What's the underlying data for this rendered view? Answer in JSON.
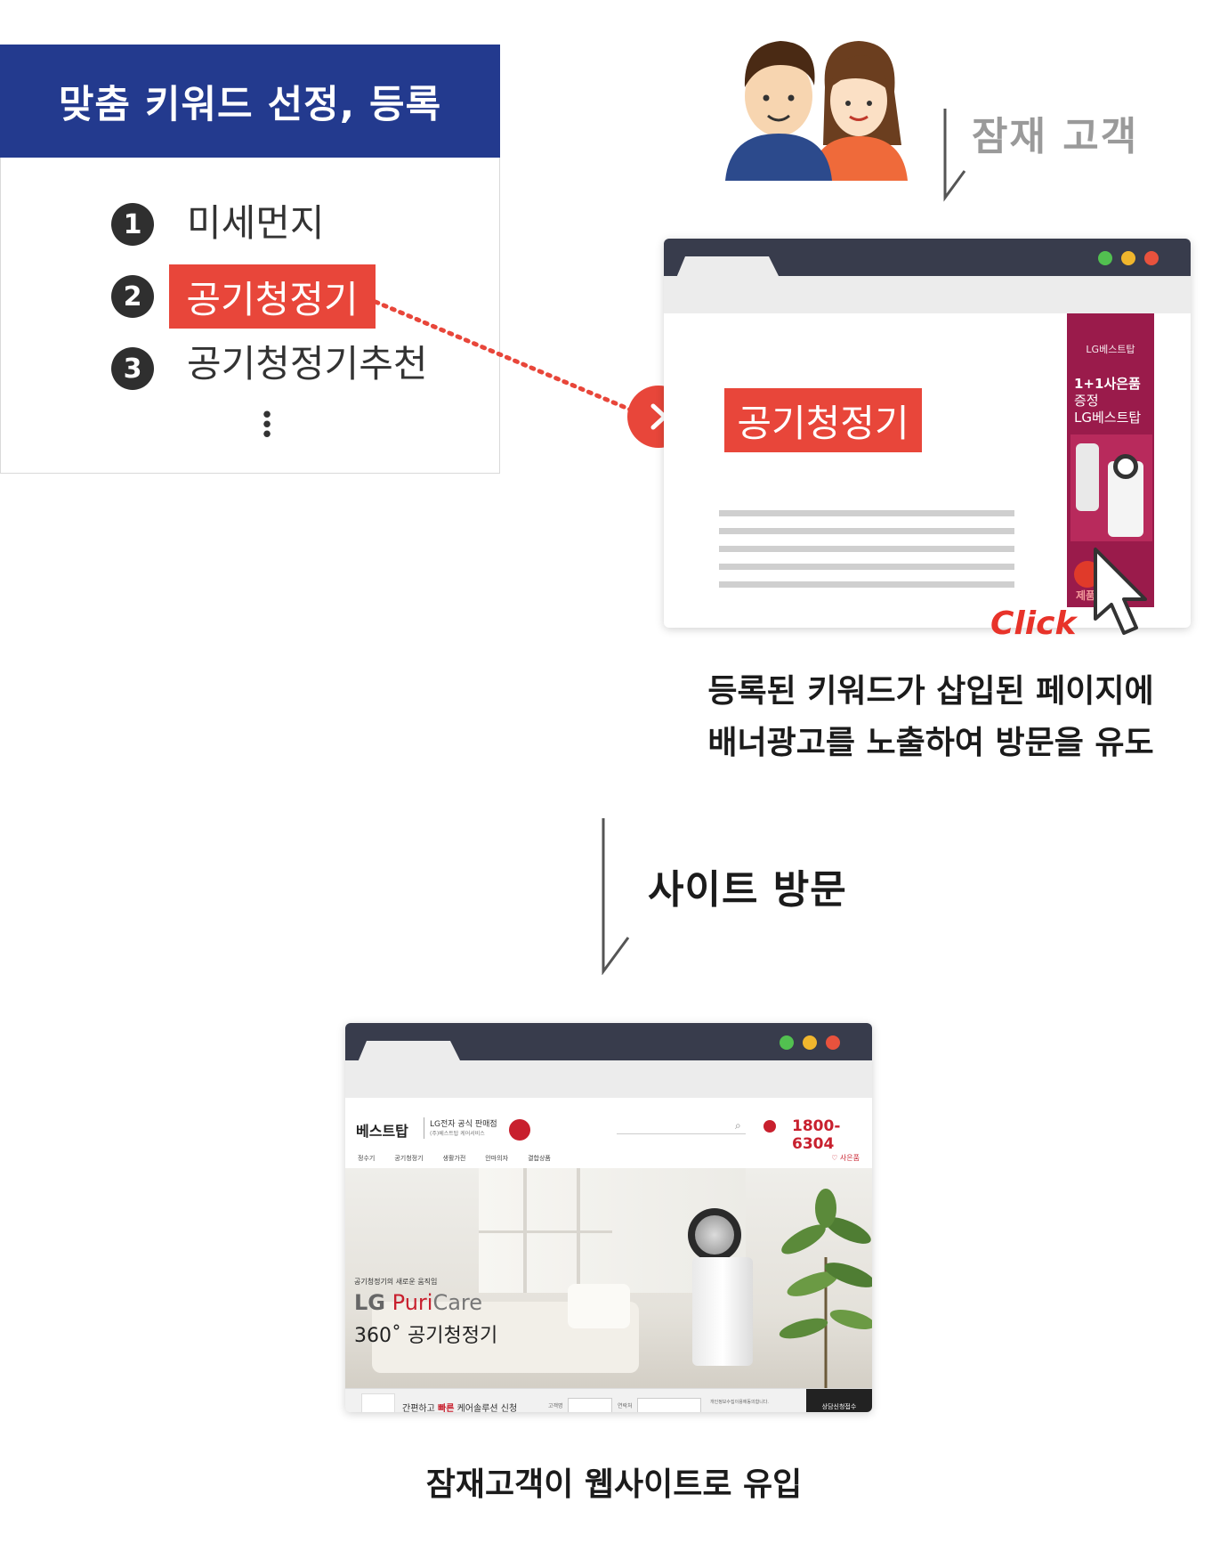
{
  "keyword_panel": {
    "title": "맞춤 키워드 선정, 등록",
    "items": [
      {
        "num": "1",
        "label": "미세먼지",
        "highlight": false
      },
      {
        "num": "2",
        "label": "공기청정기",
        "highlight": true
      },
      {
        "num": "3",
        "label": "공기청정기추천",
        "highlight": false
      }
    ],
    "more": "⋮"
  },
  "audience": {
    "label": "잠재 고객"
  },
  "browser_page": {
    "keyword": "공기청정기",
    "ad_banner": {
      "brand": "LG베스트탑",
      "line1": "1+1사은품",
      "line2": "증정",
      "line3": "LG베스트탑",
      "bottom_text": "제품"
    },
    "click_label": "Click",
    "caption_line1": "등록된 키워드가 삽입된 페이지에",
    "caption_line2": "배너광고를 노출하여 방문을 유도"
  },
  "visit": {
    "label": "사이트 방문"
  },
  "site": {
    "logo": "베스트탑",
    "official": "LG전자 공식 판매점",
    "official_sub": "(주)베스트탑 케어서비스",
    "phone": "1800-6304",
    "nav": [
      "정수기",
      "공기청정기",
      "생활가전",
      "안마의자",
      "결합상품"
    ],
    "nav_right": "♡ 사은품",
    "hero_kicker": "공기청정기의 새로운 움직임",
    "hero_brand_lg": "LG",
    "hero_brand_puri": "Puri",
    "hero_brand_care": "Care",
    "hero_model": "360˚ 공기청정기",
    "footer_text_a": "간편하고",
    "footer_text_b": "빠른",
    "footer_text_c": "케어솔루션 신청",
    "footer_name_label": "고객명",
    "footer_phone_label": "연락처",
    "footer_agree": "개인정보수집이용에동의합니다.",
    "footer_button": "상담신청접수"
  },
  "result": {
    "label": "잠재고객이 웹사이트로 유입"
  },
  "colors": {
    "navy": "#233a8e",
    "red": "#e8463a",
    "ad": "#9a1b4b",
    "dark": "#383c4c"
  }
}
